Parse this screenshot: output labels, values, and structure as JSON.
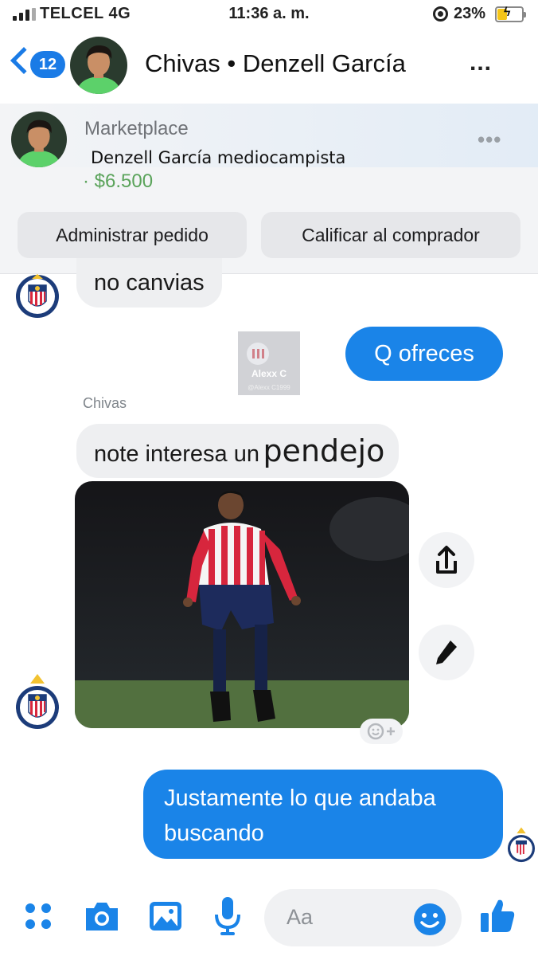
{
  "status_bar": {
    "carrier": "TELCEL 4G",
    "time": "11:36 a. m.",
    "battery_percent": "23%",
    "battery_level": 0.23,
    "signal_bars": 3,
    "icons": [
      "signal-bars-icon",
      "rotation-lock-icon",
      "battery-charging-icon"
    ]
  },
  "header": {
    "back_count": "12",
    "title": "Chivas • Denzell García",
    "more": "...",
    "icons": [
      "back-chevron-icon",
      "more-dots-icon"
    ]
  },
  "marketplace": {
    "source": "Marketplace",
    "item": "Denzell García mediocampista",
    "price": "· $6.500",
    "more": "•••",
    "buttons": {
      "manage": "Administrar pedido",
      "rate": "Calificar al comprador"
    }
  },
  "messages": [
    {
      "direction": "incoming",
      "text": "no canvias"
    },
    {
      "direction": "outgoing",
      "text": "Q ofreces"
    },
    {
      "direction": "incoming",
      "sender": "Chivas",
      "text_a": "note interesa un",
      "text_b": "pendejo"
    },
    {
      "direction": "incoming",
      "type": "image",
      "description_icon": "soccer-player-photo"
    },
    {
      "direction": "outgoing",
      "line1": "Justamente lo que andaba",
      "line2": "buscando"
    }
  ],
  "watermark": {
    "name": "Alexx C",
    "handle": "@Alexx C1999"
  },
  "image_actions": [
    "share-icon",
    "edit-icon",
    "add-reaction-icon"
  ],
  "composer": {
    "placeholder": "Aa",
    "icons": [
      "menu-dots-icon",
      "camera-icon",
      "gallery-icon",
      "microphone-icon",
      "emoji-icon",
      "thumbs-up-icon"
    ]
  },
  "colors": {
    "messenger_blue": "#1a84e8",
    "incoming_bubble": "#eeeff1",
    "price_green": "#5aa35a",
    "chivas_red": "#d7263d"
  }
}
